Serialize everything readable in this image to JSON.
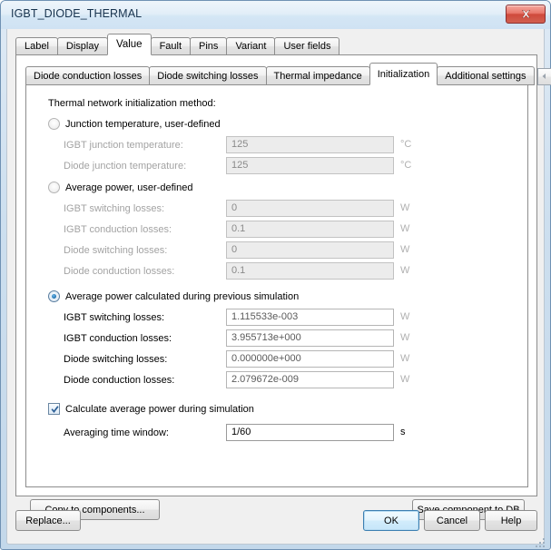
{
  "window": {
    "title": "IGBT_DIODE_THERMAL",
    "close_icon": "close-x-icon"
  },
  "outer_tabs": {
    "items": [
      {
        "label": "Label",
        "active": false
      },
      {
        "label": "Display",
        "active": false
      },
      {
        "label": "Value",
        "active": true
      },
      {
        "label": "Fault",
        "active": false
      },
      {
        "label": "Pins",
        "active": false
      },
      {
        "label": "Variant",
        "active": false
      },
      {
        "label": "User fields",
        "active": false
      }
    ]
  },
  "inner_tabs": {
    "items": [
      {
        "label": "Diode conduction losses",
        "active": false
      },
      {
        "label": "Diode switching losses",
        "active": false
      },
      {
        "label": "Thermal impedance",
        "active": false
      },
      {
        "label": "Initialization",
        "active": true
      },
      {
        "label": "Additional settings",
        "active": false
      }
    ],
    "scroll_left_icon": "triangle-left-icon",
    "scroll_right_icon": "triangle-right-icon"
  },
  "panel": {
    "heading": "Thermal network initialization method:",
    "option1": {
      "label": "Junction temperature, user-defined",
      "selected": false,
      "fields": [
        {
          "label": "IGBT junction temperature:",
          "value": "125",
          "unit": "°C"
        },
        {
          "label": "Diode junction temperature:",
          "value": "125",
          "unit": "°C"
        }
      ]
    },
    "option2": {
      "label": "Average power, user-defined",
      "selected": false,
      "fields": [
        {
          "label": "IGBT switching losses:",
          "value": "0",
          "unit": "W"
        },
        {
          "label": "IGBT conduction losses:",
          "value": "0.1",
          "unit": "W"
        },
        {
          "label": "Diode switching losses:",
          "value": "0",
          "unit": "W"
        },
        {
          "label": "Diode conduction losses:",
          "value": "0.1",
          "unit": "W"
        }
      ]
    },
    "option3": {
      "label": "Average power calculated during previous simulation",
      "selected": true,
      "fields": [
        {
          "label": "IGBT switching losses:",
          "value": "1.115533e-003",
          "unit": "W"
        },
        {
          "label": "IGBT conduction losses:",
          "value": "3.955713e+000",
          "unit": "W"
        },
        {
          "label": "Diode switching losses:",
          "value": "0.000000e+000",
          "unit": "W"
        },
        {
          "label": "Diode conduction losses:",
          "value": "2.079672e-009",
          "unit": "W"
        }
      ]
    },
    "calculate_checkbox": {
      "label": "Calculate average power during simulation",
      "checked": true,
      "checkmark_icon": "checkmark-icon"
    },
    "averaging": {
      "label": "Averaging time window:",
      "value": "1/60",
      "unit": "s"
    }
  },
  "panel_buttons": {
    "copy_to_components": "Copy to components...",
    "save_component_to_db": "Save component to DB"
  },
  "dialog_buttons": {
    "replace": "Replace...",
    "ok": "OK",
    "cancel": "Cancel",
    "help": "Help"
  }
}
